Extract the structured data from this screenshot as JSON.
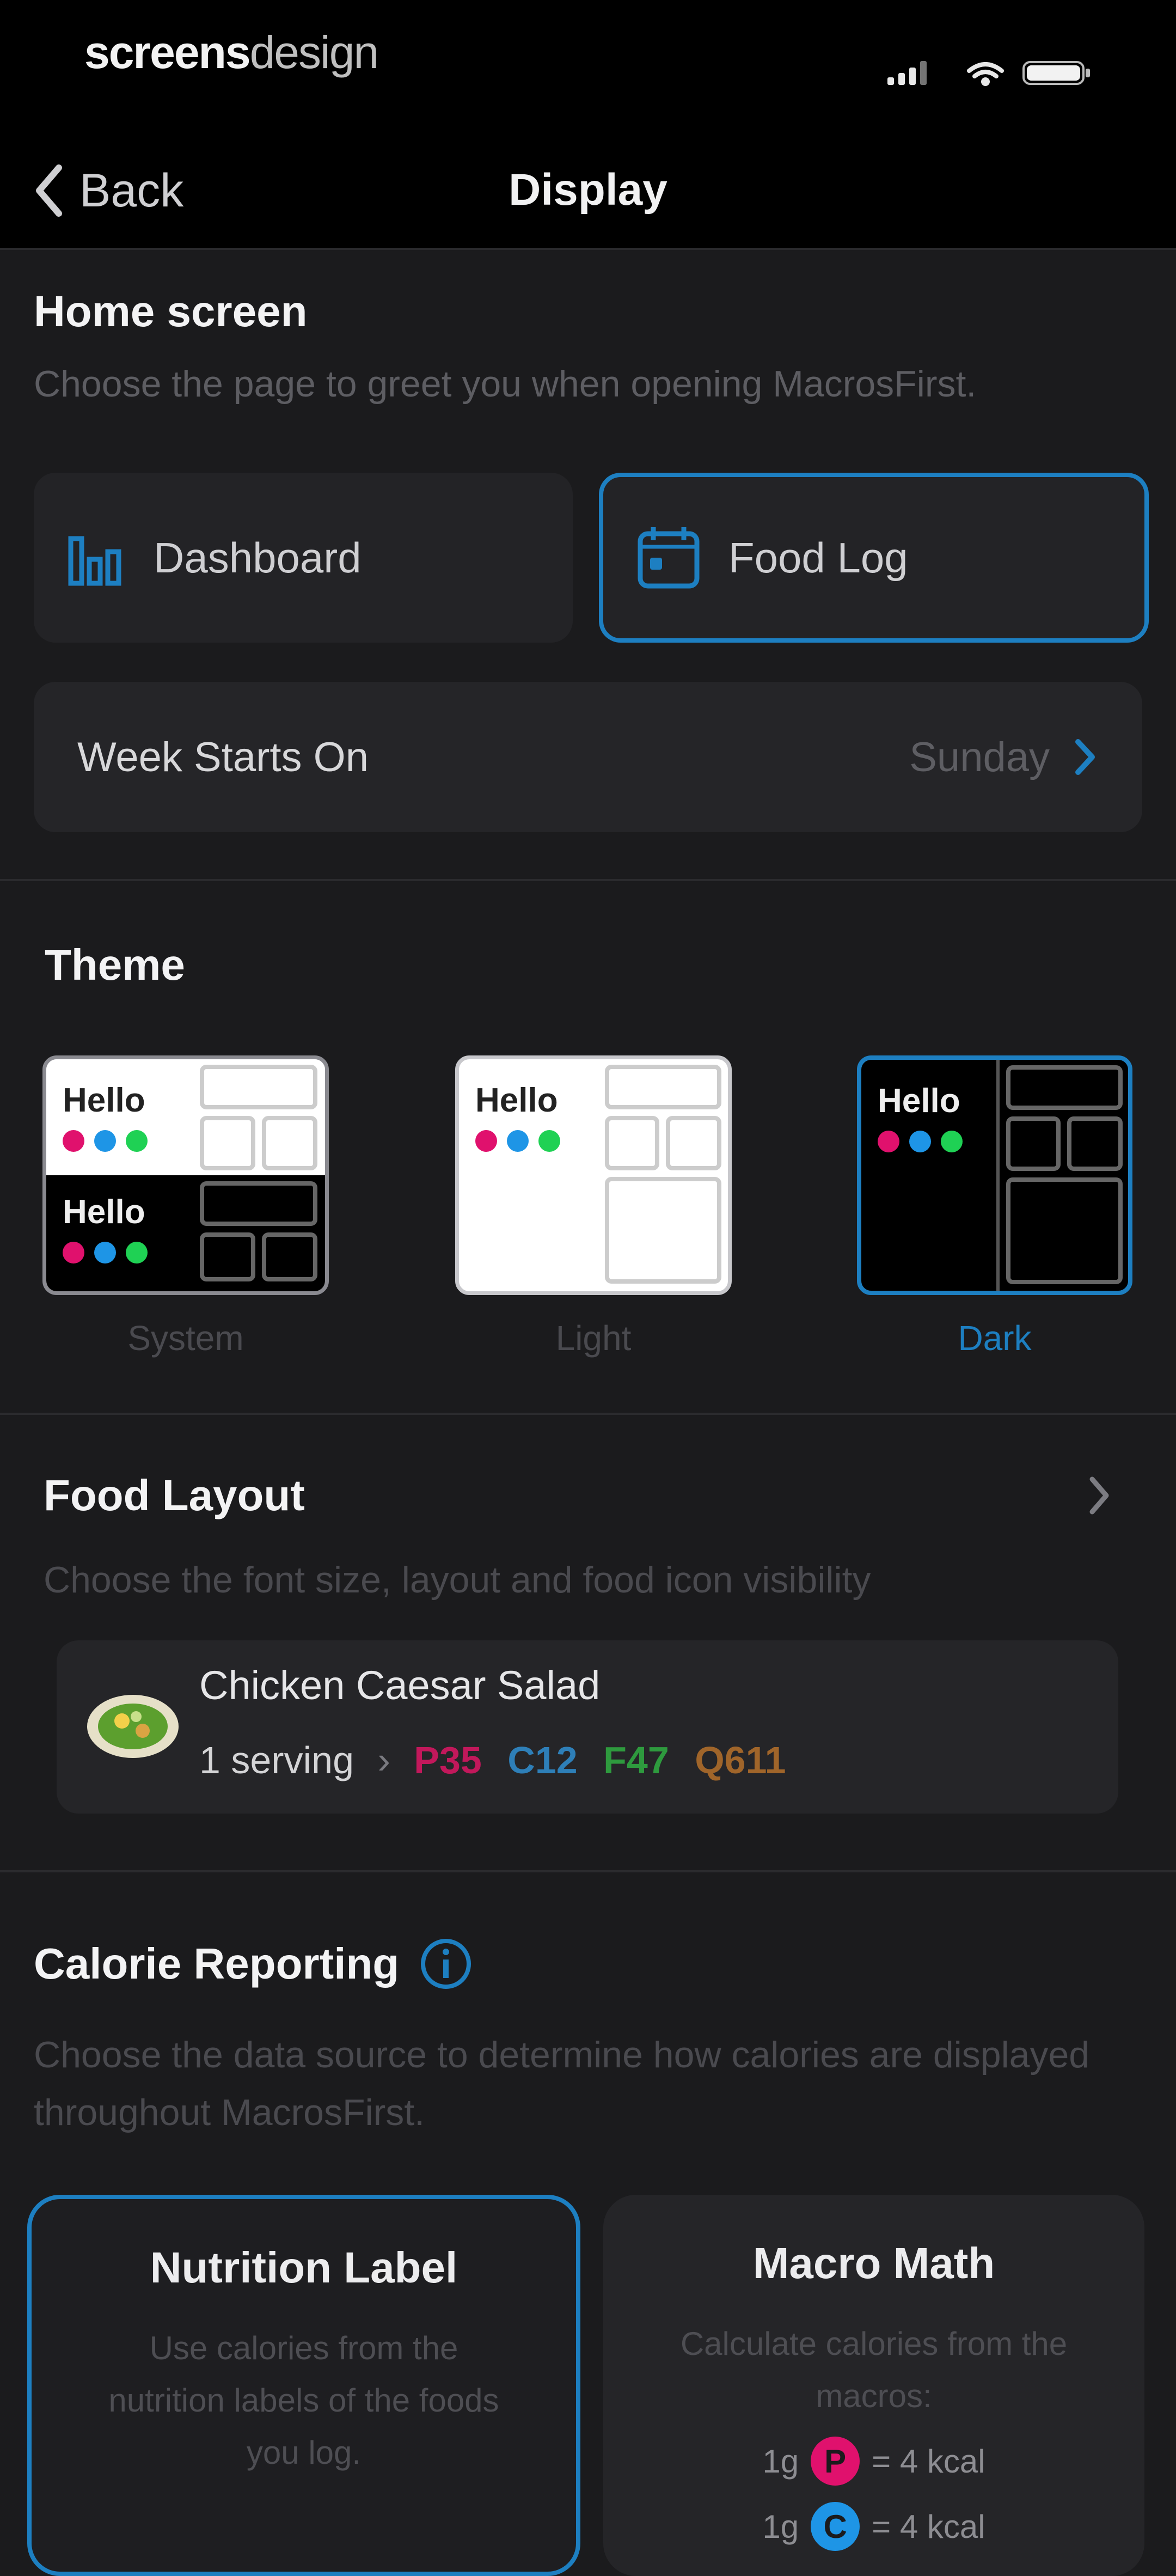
{
  "status": {
    "brand_bold": "screens",
    "brand_light": "design"
  },
  "nav": {
    "back_label": "Back",
    "title": "Display"
  },
  "home": {
    "title": "Home screen",
    "subtitle": "Choose the page to greet you when opening MacrosFirst.",
    "options": [
      {
        "label": "Dashboard",
        "icon": "bar-chart-icon",
        "selected": false
      },
      {
        "label": "Food Log",
        "icon": "calendar-icon",
        "selected": true
      }
    ],
    "week_row": {
      "label": "Week Starts On",
      "value": "Sunday"
    }
  },
  "theme": {
    "title": "Theme",
    "options": [
      {
        "label": "System",
        "selected": false
      },
      {
        "label": "Light",
        "selected": false
      },
      {
        "label": "Dark",
        "selected": true
      }
    ],
    "preview_text": "Hello",
    "dot_colors": [
      "#e0116d",
      "#1e95e6",
      "#1fd154"
    ]
  },
  "food_layout": {
    "title": "Food Layout",
    "subtitle": "Choose the font size, layout and food icon visibility",
    "sample": {
      "name": "Chicken Caesar Salad",
      "serving": "1 serving",
      "separator": "›",
      "protein": "P35",
      "carbs": "C12",
      "fat": "F47",
      "calories": "Q611"
    },
    "colors": {
      "protein": "#c2185b",
      "carbs": "#2e7fb8",
      "fat": "#2e9a3e",
      "calories": "#a0652a"
    }
  },
  "calorie_reporting": {
    "title": "Calorie Reporting",
    "subtitle": "Choose the data source to determine how calories are displayed throughout MacrosFirst.",
    "options": [
      {
        "title": "Nutrition Label",
        "desc": "Use calories from the nutrition labels of the foods you log.",
        "selected": true
      },
      {
        "title": "Macro Math",
        "desc": "Calculate calories from the macros:",
        "selected": false
      }
    ],
    "math": [
      {
        "amount": "1g",
        "macro": "P",
        "equals": "= 4 kcal",
        "color": "#e0116d"
      },
      {
        "amount": "1g",
        "macro": "C",
        "equals": "= 4 kcal",
        "color": "#1e95e6"
      }
    ]
  },
  "accent": "#1d7fc1"
}
